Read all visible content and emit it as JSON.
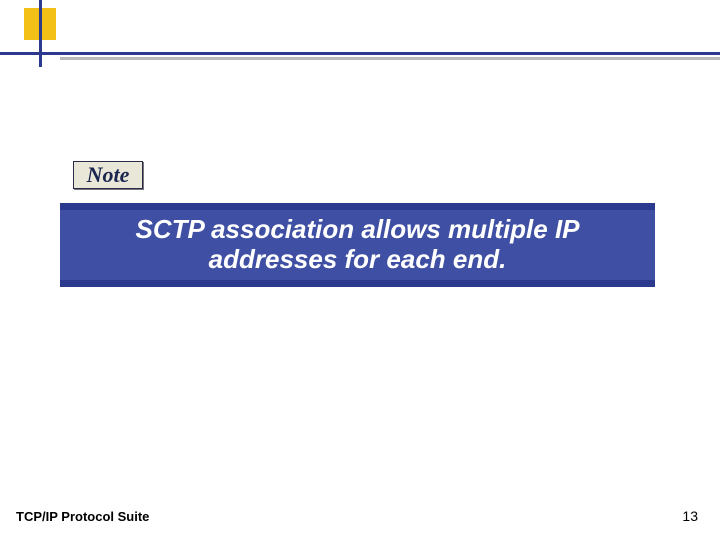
{
  "note": {
    "label": "Note",
    "text": "SCTP association allows multiple IP addresses for each end."
  },
  "footer": {
    "left": "TCP/IP Protocol Suite",
    "page": "13"
  }
}
